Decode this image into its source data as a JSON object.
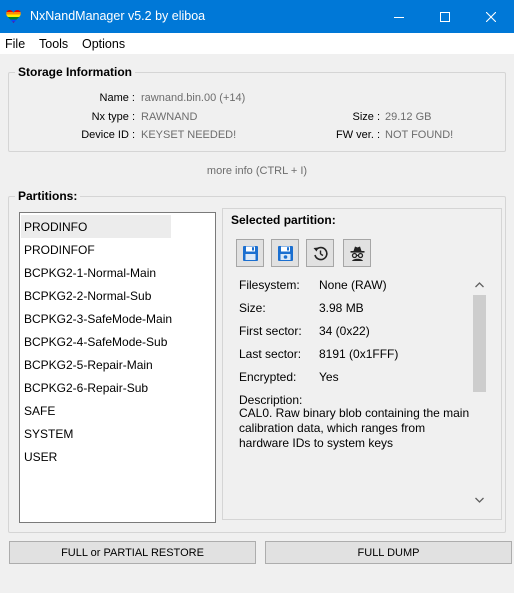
{
  "window": {
    "title": "NxNandManager v5.2 by eliboa",
    "app_icon": "rainbow-heart-icon",
    "controls": [
      "minimize-icon",
      "maximize-icon",
      "close-icon"
    ]
  },
  "menu": {
    "items": [
      "File",
      "Tools",
      "Options"
    ]
  },
  "storage": {
    "title": "Storage Information",
    "name_label": "Name :",
    "name_value": "rawnand.bin.00 (+14)",
    "type_label": "Nx type :",
    "type_value": "RAWNAND",
    "device_label": "Device ID :",
    "device_value": "KEYSET NEEDED!",
    "size_label": "Size :",
    "size_value": "29.12 GB",
    "fw_label": "FW ver. :",
    "fw_value": "NOT FOUND!",
    "more_info": "more info (CTRL + I)"
  },
  "partitions": {
    "title": "Partitions:",
    "selected_index": 0,
    "items": [
      "PRODINFO",
      "PRODINFOF",
      "BCPKG2-1-Normal-Main",
      "BCPKG2-2-Normal-Sub",
      "BCPKG2-3-SafeMode-Main",
      "BCPKG2-4-SafeMode-Sub",
      "BCPKG2-5-Repair-Main",
      "BCPKG2-6-Repair-Sub",
      "SAFE",
      "SYSTEM",
      "USER"
    ]
  },
  "selected": {
    "title": "Selected partition:",
    "tool_icons": [
      "save-icon",
      "save-as-icon",
      "restore-icon",
      "incognito-icon"
    ],
    "filesystem_label": "Filesystem:",
    "filesystem_value": "None (RAW)",
    "size_label": "Size:",
    "size_value": "3.98 MB",
    "first_label": "First sector:",
    "first_value": "34 (0x22)",
    "last_label": "Last sector:",
    "last_value": "8191 (0x1FFF)",
    "encrypted_label": "Encrypted:",
    "encrypted_value": "Yes",
    "description_label": "Description:",
    "description_value": "CAL0. Raw binary blob containing the main calibration data, which ranges from hardware IDs to system keys"
  },
  "buttons": {
    "restore": "FULL or PARTIAL RESTORE",
    "dump": "FULL DUMP"
  },
  "colors": {
    "titlebar": "#0078d7",
    "accent_blue": "#1b6fd0",
    "muted_text": "#6d6d6d"
  }
}
